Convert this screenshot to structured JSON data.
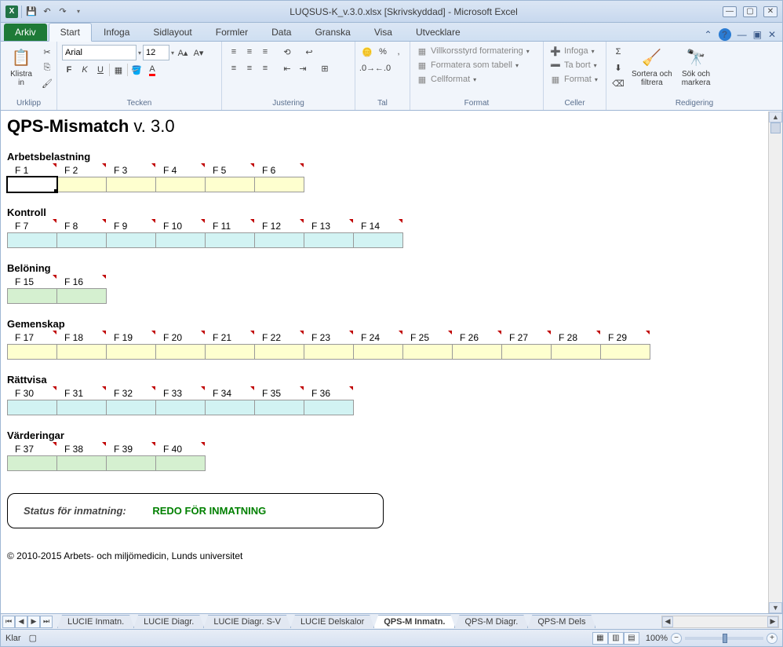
{
  "window": {
    "title": "LUQSUS-K_v.3.0.xlsx  [Skrivskyddad]  -  Microsoft Excel"
  },
  "ribbon": {
    "file_tab": "Arkiv",
    "tabs": [
      "Start",
      "Infoga",
      "Sidlayout",
      "Formler",
      "Data",
      "Granska",
      "Visa",
      "Utvecklare"
    ],
    "active_tab": "Start",
    "groups": {
      "clipboard": {
        "label": "Urklipp",
        "paste": "Klistra\nin"
      },
      "font": {
        "label": "Tecken",
        "name": "Arial",
        "size": "12"
      },
      "alignment": {
        "label": "Justering"
      },
      "number": {
        "label": "Tal"
      },
      "styles": {
        "label": "Format",
        "cond": "Villkorsstyrd formatering",
        "table": "Formatera som tabell",
        "cell": "Cellformat"
      },
      "cells": {
        "label": "Celler",
        "insert": "Infoga",
        "delete": "Ta bort",
        "format": "Format"
      },
      "editing": {
        "label": "Redigering",
        "sort": "Sortera och\nfiltrera",
        "find": "Sök och\nmarkera"
      }
    }
  },
  "sheet": {
    "main_title": "QPS-Mismatch",
    "main_version": " v. 3.0",
    "sections": [
      {
        "title": "Arbetsbelastning",
        "color": "yellow",
        "headers": [
          "F 1",
          "F 2",
          "F 3",
          "F 4",
          "F 5",
          "F 6"
        ]
      },
      {
        "title": "Kontroll",
        "color": "cyan",
        "headers": [
          "F 7",
          "F 8",
          "F 9",
          "F 10",
          "F 11",
          "F 12",
          "F 13",
          "F 14"
        ]
      },
      {
        "title": "Belöning",
        "color": "green",
        "headers": [
          "F 15",
          "F 16"
        ]
      },
      {
        "title": "Gemenskap",
        "color": "yellow",
        "headers": [
          "F 17",
          "F 18",
          "F 19",
          "F 20",
          "F 21",
          "F 22",
          "F 23",
          "F 24",
          "F 25",
          "F 26",
          "F 27",
          "F 28",
          "F 29"
        ]
      },
      {
        "title": "Rättvisa",
        "color": "cyan",
        "headers": [
          "F 30",
          "F 31",
          "F 32",
          "F 33",
          "F 34",
          "F 35",
          "F 36"
        ]
      },
      {
        "title": "Värderingar",
        "color": "green",
        "headers": [
          "F 37",
          "F 38",
          "F 39",
          "F 40"
        ]
      }
    ],
    "status_label": "Status för inmatning:",
    "status_value": "REDO FÖR INMATNING",
    "copyright": "© 2010-2015 Arbets- och miljömedicin, Lunds universitet"
  },
  "sheet_tabs": [
    "LUCIE Inmatn.",
    "LUCIE Diagr.",
    "LUCIE Diagr. S-V",
    "LUCIE Delskalor",
    "QPS-M Inmatn.",
    "QPS-M Diagr.",
    "QPS-M Dels"
  ],
  "active_sheet": "QPS-M Inmatn.",
  "statusbar": {
    "ready": "Klar",
    "zoom": "100%"
  }
}
